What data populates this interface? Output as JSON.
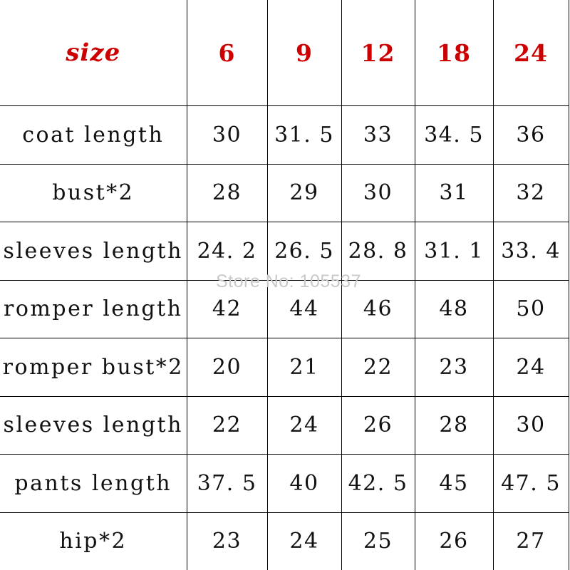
{
  "table": {
    "header": {
      "label": "size",
      "sizes": [
        "6",
        "9",
        "12",
        "18",
        "24"
      ]
    },
    "rows": [
      {
        "label": "coat length",
        "values": [
          "30",
          "31. 5",
          "33",
          "34. 5",
          "36"
        ]
      },
      {
        "label": "bust*2",
        "values": [
          "28",
          "29",
          "30",
          "31",
          "32"
        ]
      },
      {
        "label": "sleeves length",
        "values": [
          "24. 2",
          "26. 5",
          "28. 8",
          "31. 1",
          "33. 4"
        ]
      },
      {
        "label": "romper length",
        "values": [
          "42",
          "44",
          "46",
          "48",
          "50"
        ]
      },
      {
        "label": "romper bust*2",
        "values": [
          "20",
          "21",
          "22",
          "23",
          "24"
        ]
      },
      {
        "label": "sleeves length",
        "values": [
          "22",
          "24",
          "26",
          "28",
          "30"
        ]
      },
      {
        "label": "pants length",
        "values": [
          "37. 5",
          "40",
          "42. 5",
          "45",
          "47. 5"
        ]
      },
      {
        "label": "hip*2",
        "values": [
          "23",
          "24",
          "25",
          "26",
          "27"
        ]
      }
    ]
  },
  "watermark": {
    "text": "Store No: 105537"
  },
  "colors": {
    "header_text": "#cc0000",
    "body_text": "#111111",
    "grid_line": "#000000",
    "background": "#ffffff",
    "watermark_text": "#c9c9c9"
  }
}
